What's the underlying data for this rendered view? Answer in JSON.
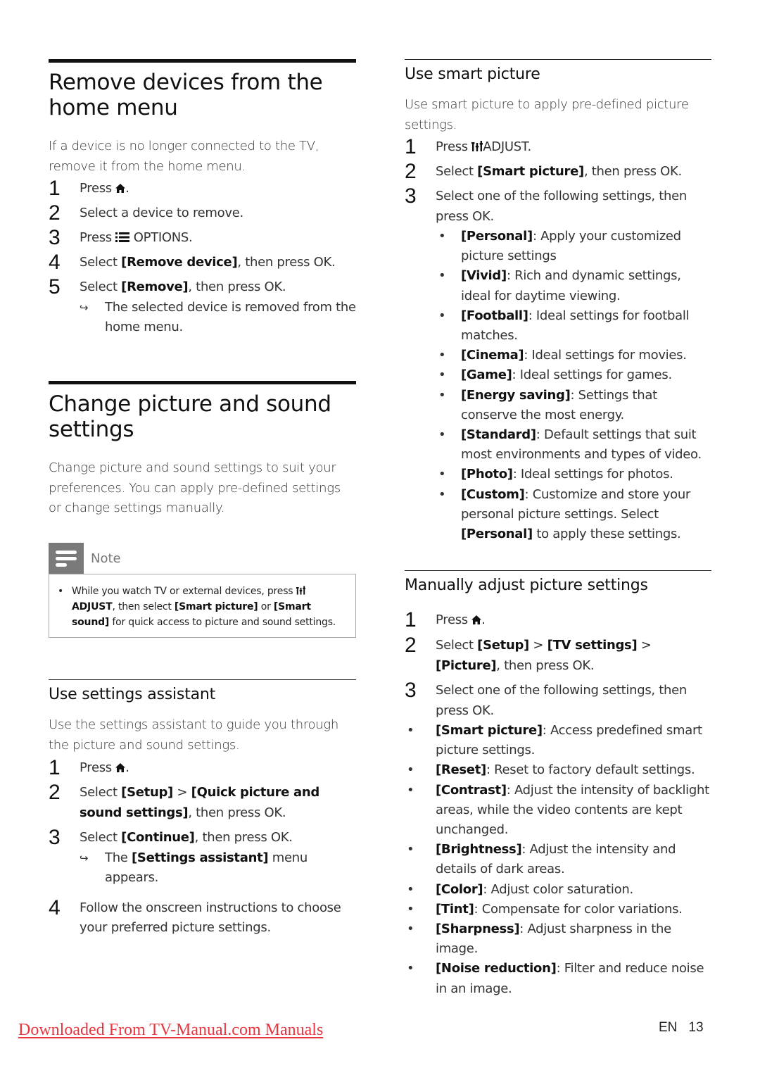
{
  "left": {
    "remove_section": {
      "title_line1": "Remove devices from the",
      "title_line2": "home menu",
      "intro": "If a device is no longer connected to the TV, remove it from the home menu.",
      "steps": [
        {
          "num": "1",
          "pre": "Press ",
          "icon": "home-icon",
          "post": "."
        },
        {
          "num": "2",
          "text": "Select a device to remove."
        },
        {
          "num": "3",
          "pre": "Press ",
          "icon": "options-icon",
          "post": " OPTIONS."
        },
        {
          "num": "4",
          "pre": "Select ",
          "bold": "[Remove device]",
          "post": ", then press OK."
        },
        {
          "num": "5",
          "pre": "Select ",
          "bold": "[Remove]",
          "post": ", then press OK."
        }
      ],
      "result_arrow": "↪",
      "result_text": "The selected device is removed from the home menu."
    },
    "change_section": {
      "title_line1": "Change picture and sound",
      "title_line2": "settings",
      "intro": "Change picture and sound settings to suit your preferences. You can apply pre-defined settings or change settings manually."
    },
    "note": {
      "label": "Note",
      "bullet": "•",
      "text_pre": "While you watch TV or external devices, press ",
      "adjust_bold": "ADJUST",
      "text_mid": ", then select ",
      "bold1": "[Smart picture]",
      "or": " or ",
      "bold2": "[Smart sound]",
      "text_post": " for quick access to picture and sound settings."
    },
    "assistant_section": {
      "title": "Use settings assistant",
      "intro": "Use the settings assistant to guide you through the picture and sound settings.",
      "steps": [
        {
          "num": "1",
          "pre": "Press ",
          "icon": "home-icon",
          "post": "."
        },
        {
          "num": "2",
          "pre": "Select ",
          "bold1": "[Setup]",
          "sep": " > ",
          "bold2": "[Quick picture and sound settings]",
          "post": ", then press OK."
        },
        {
          "num": "3",
          "pre": "Select ",
          "bold": "[Continue]",
          "post": ", then press OK."
        },
        {
          "num": "4",
          "text": "Follow the onscreen instructions to choose your preferred picture settings."
        }
      ],
      "result_arrow": "↪",
      "result_pre": "The ",
      "result_bold": "[Settings assistant]",
      "result_post": " menu appears."
    }
  },
  "right": {
    "smart_section": {
      "title": "Use smart picture",
      "intro": "Use smart picture to apply pre-defined picture settings.",
      "steps": [
        {
          "num": "1",
          "pre": "Press ",
          "icon": "adjust-icon",
          "post": "ADJUST."
        },
        {
          "num": "2",
          "pre": "Select ",
          "bold": "[Smart picture]",
          "post": ", then press OK."
        },
        {
          "num": "3",
          "text": "Select one of the following settings, then press OK."
        }
      ],
      "bullets": [
        {
          "bold": "[Personal]",
          "text": ": Apply your customized picture settings"
        },
        {
          "bold": "[Vivid]",
          "text": ": Rich and dynamic settings, ideal for daytime viewing."
        },
        {
          "bold": "[Football]",
          "text": ": Ideal settings for football matches."
        },
        {
          "bold": "[Cinema]",
          "text": ": Ideal settings for movies."
        },
        {
          "bold": "[Game]",
          "text": ": Ideal settings for games."
        },
        {
          "bold": "[Energy saving]",
          "text": ": Settings that conserve the most energy."
        },
        {
          "bold": "[Standard]",
          "text": ": Default settings that suit most environments and types of video."
        },
        {
          "bold": "[Photo]",
          "text": ": Ideal settings for photos."
        },
        {
          "bold": "[Custom]",
          "text": ": Customize and store your personal picture settings. Select ",
          "bold2": "[Personal]",
          "text2": " to apply these settings."
        }
      ]
    },
    "manual_section": {
      "title": "Manually adjust picture settings",
      "steps": [
        {
          "num": "1",
          "pre": "Press ",
          "icon": "home-icon",
          "post": "."
        },
        {
          "num": "2",
          "pre": "Select ",
          "bold1": "[Setup]",
          "sep1": " > ",
          "bold2": "[TV settings]",
          "sep2": " > ",
          "bold3": "[Picture]",
          "post": ", then press OK."
        },
        {
          "num": "3",
          "text": "Select one of the following settings, then press OK."
        }
      ],
      "bullets": [
        {
          "bold": "[Smart picture]",
          "text": ": Access predefined smart picture settings."
        },
        {
          "bold": "[Reset]",
          "text": ": Reset to factory default settings."
        },
        {
          "bold": "[Contrast]",
          "text": ": Adjust the intensity of backlight areas, while the video contents are kept unchanged."
        },
        {
          "bold": "[Brightness]",
          "text": ": Adjust the intensity and details of dark areas."
        },
        {
          "bold": "[Color]",
          "text": ": Adjust color saturation."
        },
        {
          "bold": "[Tint]",
          "text": ": Compensate for color variations."
        },
        {
          "bold": "[Sharpness]",
          "text": ": Adjust sharpness in the image."
        },
        {
          "bold": "[Noise reduction]",
          "text": ": Filter and reduce noise in an image."
        }
      ]
    }
  },
  "footer": {
    "link_text": "Downloaded From TV-Manual.com Manuals",
    "link_color": "#e8363f",
    "lang": "EN",
    "page": "13"
  },
  "bullet_char": "•"
}
